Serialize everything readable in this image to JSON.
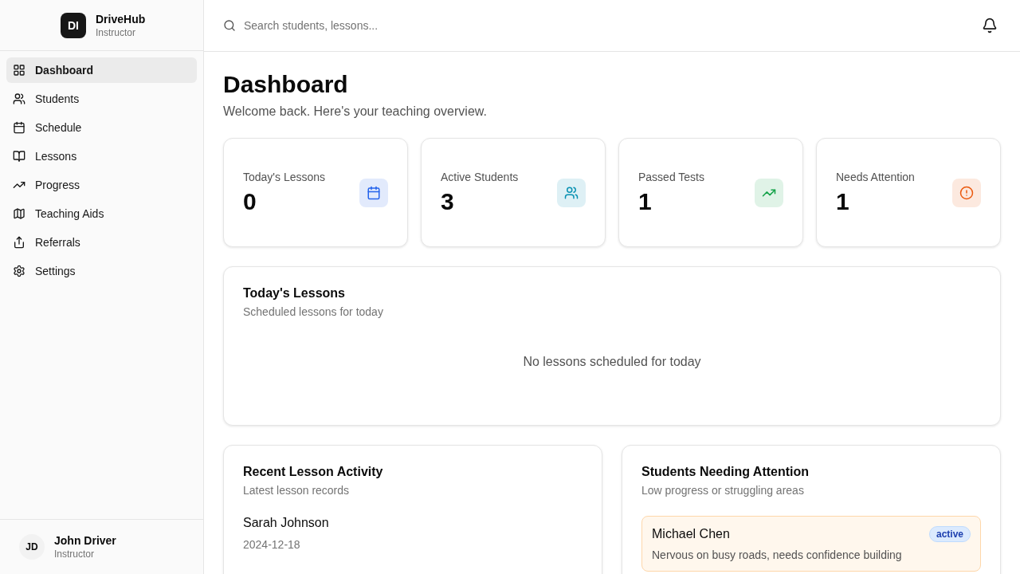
{
  "brand": {
    "logo": "DI",
    "name": "DriveHub",
    "role": "Instructor"
  },
  "nav": [
    {
      "label": "Dashboard",
      "kind": "grid",
      "selected": true
    },
    {
      "label": "Students",
      "kind": "users",
      "selected": false
    },
    {
      "label": "Schedule",
      "kind": "calendar",
      "selected": false
    },
    {
      "label": "Lessons",
      "kind": "book",
      "selected": false
    },
    {
      "label": "Progress",
      "kind": "trend",
      "selected": false
    },
    {
      "label": "Teaching Aids",
      "kind": "map",
      "selected": false
    },
    {
      "label": "Referrals",
      "kind": "share",
      "selected": false
    },
    {
      "label": "Settings",
      "kind": "settings",
      "selected": false
    }
  ],
  "user": {
    "initials": "JD",
    "name": "John Driver",
    "role": "Instructor"
  },
  "search": {
    "placeholder": "Search students, lessons..."
  },
  "page": {
    "title": "Dashboard",
    "subtitle": "Welcome back. Here's your teaching overview."
  },
  "stats": [
    {
      "label": "Today's Lessons",
      "value": "0",
      "kind": "calendar",
      "color": "#2563eb"
    },
    {
      "label": "Active Students",
      "value": "3",
      "kind": "users",
      "color": "#0891b2"
    },
    {
      "label": "Passed Tests",
      "value": "1",
      "kind": "trend",
      "color": "#16a34a"
    },
    {
      "label": "Needs Attention",
      "value": "1",
      "kind": "alert",
      "color": "#ea580c"
    }
  ],
  "today": {
    "title": "Today's Lessons",
    "subtitle": "Scheduled lessons for today",
    "empty": "No lessons scheduled for today"
  },
  "recent": {
    "title": "Recent Lesson Activity",
    "subtitle": "Latest lesson records",
    "items": [
      {
        "student": "Sarah Johnson",
        "date": "2024-12-18"
      }
    ]
  },
  "attention": {
    "title": "Students Needing Attention",
    "subtitle": "Low progress or struggling areas",
    "items": [
      {
        "name": "Michael Chen",
        "status": "active",
        "note": "Nervous on busy roads, needs confidence building"
      }
    ]
  }
}
